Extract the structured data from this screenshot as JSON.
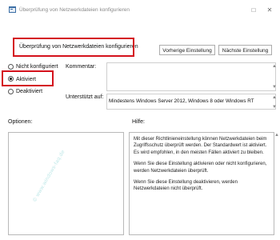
{
  "window": {
    "title": "Überprüfung von Netzwerkdateien konfigurieren",
    "icons": {
      "app": "policy-settings-icon",
      "minimize": "minimize-icon",
      "close": "close-icon"
    }
  },
  "header": {
    "policy_name": "Überprüfung von Netzwerkdateien konfigurieren",
    "prev_button": "Vorherige Einstellung",
    "next_button": "Nächste Einstellung"
  },
  "state_options": [
    {
      "label": "Nicht konfiguriert",
      "selected": false
    },
    {
      "label": "Aktiviert",
      "selected": true
    },
    {
      "label": "Deaktiviert",
      "selected": false
    }
  ],
  "comment": {
    "label": "Kommentar:",
    "value": ""
  },
  "supported": {
    "label": "Unterstützt auf:",
    "value": "Mindestens Windows Server 2012, Windows 8 oder Windows RT"
  },
  "options": {
    "label": "Optionen:"
  },
  "help": {
    "label": "Hilfe:",
    "paragraphs": [
      "Mit dieser Richtlinieneinstellung können Netzwerkdateien beim Zugriffsschutz überprüft werden. Der Standardwert ist aktiviert. Es wird empfohlen, in den meisten Fällen aktiviert zu bleiben.",
      "Wenn Sie diese Einstellung aktivieren oder nicht konfigurieren, werden Netzwerkdateien überprüft.",
      "Wenn Sie diese Einstellung deaktivieren, werden Netzwerkdateien nicht überprüft."
    ]
  },
  "watermark": "© www.windows-faq.de",
  "colors": {
    "highlight": "#d4111c",
    "watermark": "#bfe8e8"
  }
}
